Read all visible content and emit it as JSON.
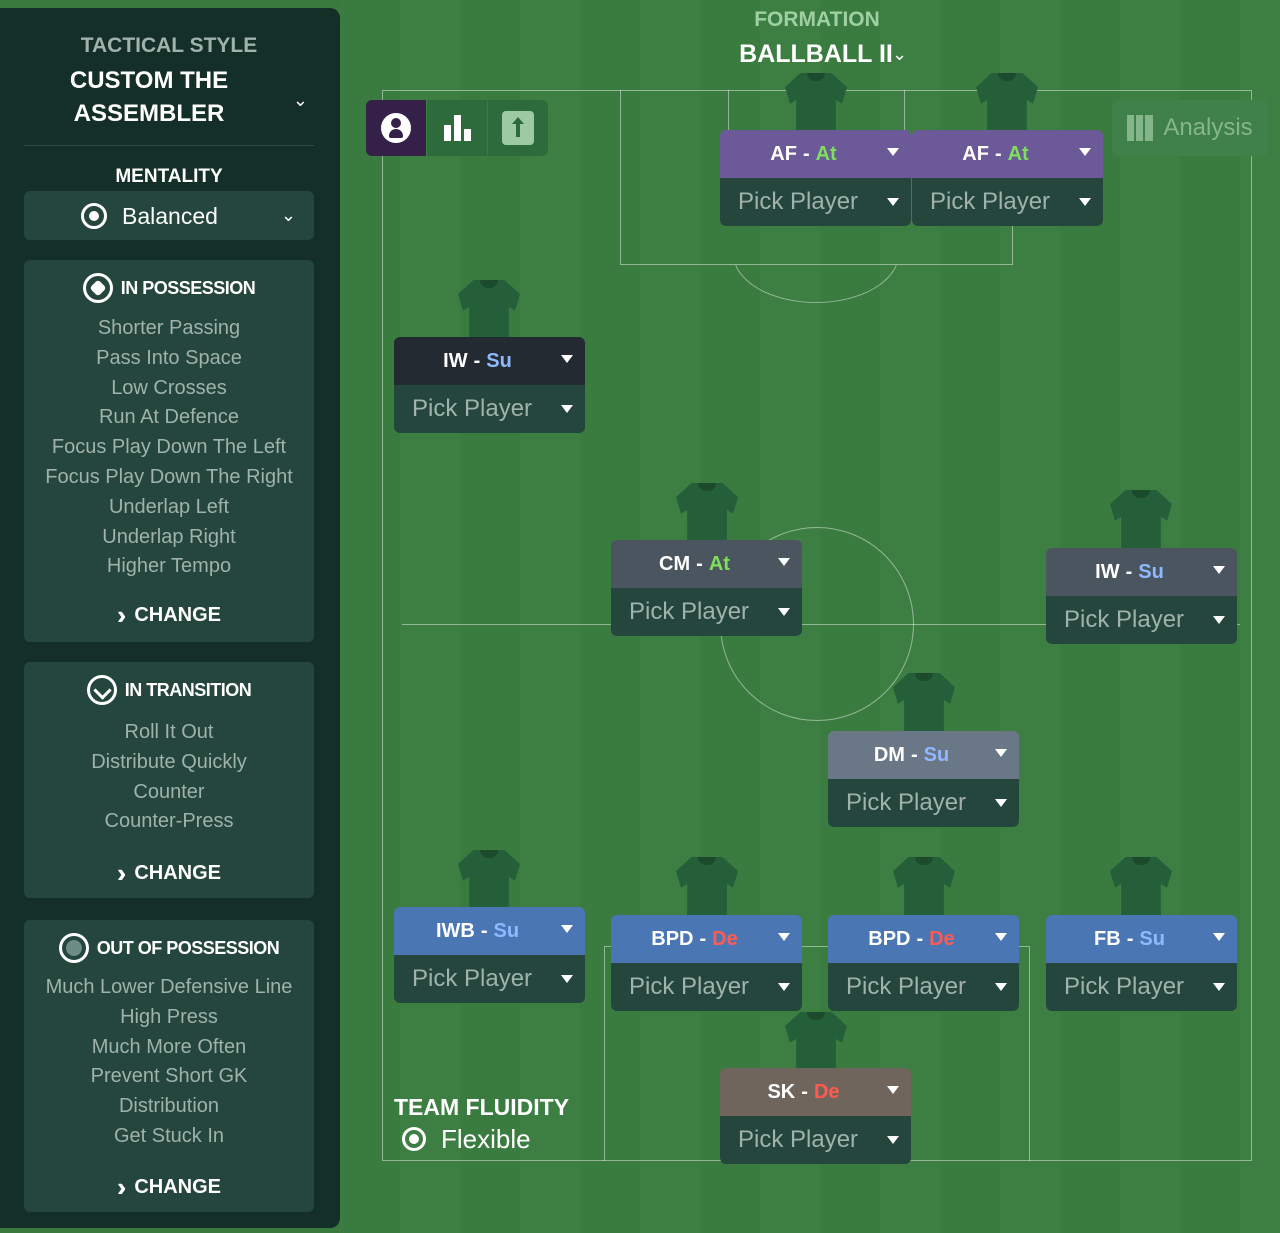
{
  "sidebar": {
    "tactical_style_label": "TACTICAL STYLE",
    "tactical_style_name": "CUSTOM THE ASSEMBLER",
    "mentality_label": "MENTALITY",
    "mentality_value": "Balanced",
    "in_possession": {
      "title": "IN POSSESSION",
      "items": [
        "Shorter Passing",
        "Pass Into Space",
        "Low Crosses",
        "Run At Defence",
        "Focus Play Down The Left",
        "Focus Play Down The Right",
        "Underlap Left",
        "Underlap Right",
        "Higher Tempo"
      ],
      "change_label": "CHANGE"
    },
    "in_transition": {
      "title": "IN TRANSITION",
      "items": [
        "Roll It Out",
        "Distribute Quickly",
        "Counter",
        "Counter-Press"
      ],
      "change_label": "CHANGE"
    },
    "out_of_possession": {
      "title": "OUT OF POSSESSION",
      "items": [
        "Much Lower Defensive Line",
        "High Press",
        "Much More Often",
        "Prevent Short GK",
        "Distribution",
        "Get Stuck In"
      ],
      "change_label": "CHANGE"
    }
  },
  "formation": {
    "label": "FORMATION",
    "name": "BALLBALL II"
  },
  "toolbar": {
    "icons": [
      "person-icon",
      "bar-chart-icon",
      "upload-icon"
    ],
    "analysis_label": "Analysis"
  },
  "players": [
    {
      "role": "AF",
      "duty": "At",
      "pick": "Pick Player"
    },
    {
      "role": "AF",
      "duty": "At",
      "pick": "Pick Player"
    },
    {
      "role": "IW",
      "duty": "Su",
      "pick": "Pick Player"
    },
    {
      "role": "CM",
      "duty": "At",
      "pick": "Pick Player"
    },
    {
      "role": "IW",
      "duty": "Su",
      "pick": "Pick Player"
    },
    {
      "role": "DM",
      "duty": "Su",
      "pick": "Pick Player"
    },
    {
      "role": "IWB",
      "duty": "Su",
      "pick": "Pick Player"
    },
    {
      "role": "BPD",
      "duty": "De",
      "pick": "Pick Player"
    },
    {
      "role": "BPD",
      "duty": "De",
      "pick": "Pick Player"
    },
    {
      "role": "FB",
      "duty": "Su",
      "pick": "Pick Player"
    },
    {
      "role": "SK",
      "duty": "De",
      "pick": "Pick Player"
    }
  ],
  "team_fluidity": {
    "label": "TEAM FLUIDITY",
    "value": "Flexible"
  },
  "colors": {
    "duty_attack": "#7ee05a",
    "duty_support": "#8fb8ff",
    "duty_defend": "#ff5a4f",
    "pitch": "#3b7a3f",
    "sidebar": "#142e28"
  }
}
